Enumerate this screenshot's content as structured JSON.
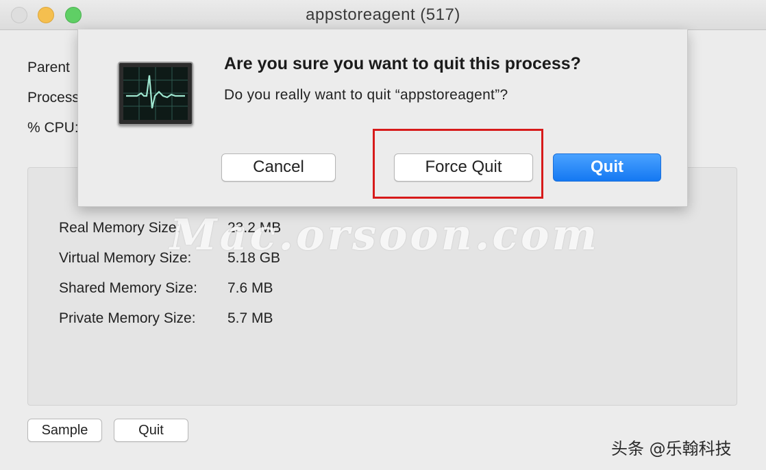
{
  "window": {
    "title": "appstoreagent (517)"
  },
  "info": {
    "parent_label": "Parent",
    "process_label": "Process",
    "cpu_label": "% CPU:"
  },
  "memory": {
    "rows": [
      {
        "label": "Real Memory Size:",
        "value": "23.2 MB"
      },
      {
        "label": "Virtual Memory Size:",
        "value": "5.18 GB"
      },
      {
        "label": "Shared Memory Size:",
        "value": "7.6 MB"
      },
      {
        "label": "Private Memory Size:",
        "value": "5.7 MB"
      }
    ]
  },
  "bottom_buttons": {
    "sample": "Sample",
    "quit": "Quit"
  },
  "dialog": {
    "icon": "activity-monitor-icon",
    "title": "Are you sure you want to quit this process?",
    "message": "Do you really want to quit “appstoreagent”?",
    "cancel": "Cancel",
    "force_quit": "Force Quit",
    "quit": "Quit"
  },
  "overlays": {
    "watermark": "Mac.orsoon.com",
    "source_mark": "头条 @乐翰科技"
  },
  "colors": {
    "highlight_box": "#d71a1a",
    "default_button": "#1478f2",
    "close_button": "#dedede",
    "minimize_button": "#f5bf4f",
    "zoom_button": "#5fcf65"
  }
}
